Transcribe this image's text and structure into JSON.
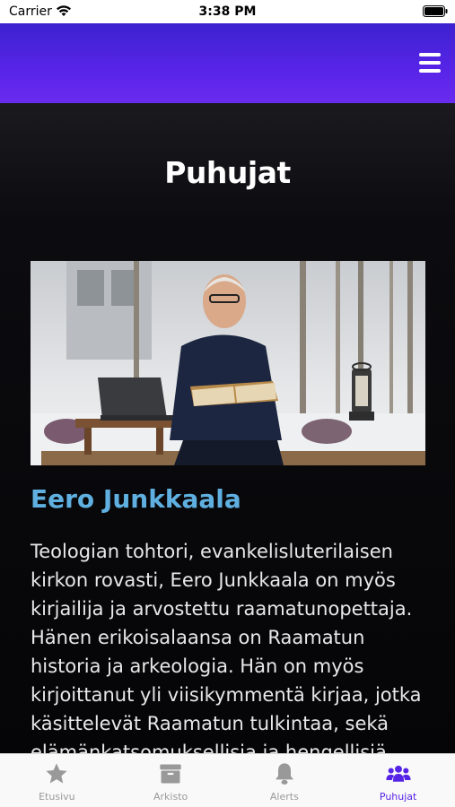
{
  "status_bar": {
    "carrier": "Carrier",
    "time": "3:38 PM"
  },
  "header": {
    "menu_icon": "hamburger-menu-icon",
    "gradient_colors": [
      "#3c22cf",
      "#6a2bf0"
    ]
  },
  "page": {
    "title": "Puhujat"
  },
  "speaker": {
    "name": "Eero Junkkaala",
    "bio": "Teologian tohtori, evankelisluterilaisen kirkon rovasti, Eero Junkkaala on myös kirjailija ja arvostettu raamatunopettaja. Hänen erikoisalaansa on Raamatun historia ja arkeologia. Hän on myös kirjoittanut yli viisikymmentä kirjaa, jotka käsittelevät Raamatun tulkintaa, sekä elämänkatsomuksellisia ja hengellisiä",
    "name_color": "#5fb0e0"
  },
  "tab_bar": {
    "tabs": [
      {
        "label": "Etusivu",
        "icon": "star-icon",
        "active": false
      },
      {
        "label": "Arkisto",
        "icon": "archive-box-icon",
        "active": false
      },
      {
        "label": "Alerts",
        "icon": "bell-icon",
        "active": false
      },
      {
        "label": "Puhujat",
        "icon": "users-icon",
        "active": true
      }
    ],
    "active_color": "#5624e6",
    "inactive_color": "#999999"
  }
}
